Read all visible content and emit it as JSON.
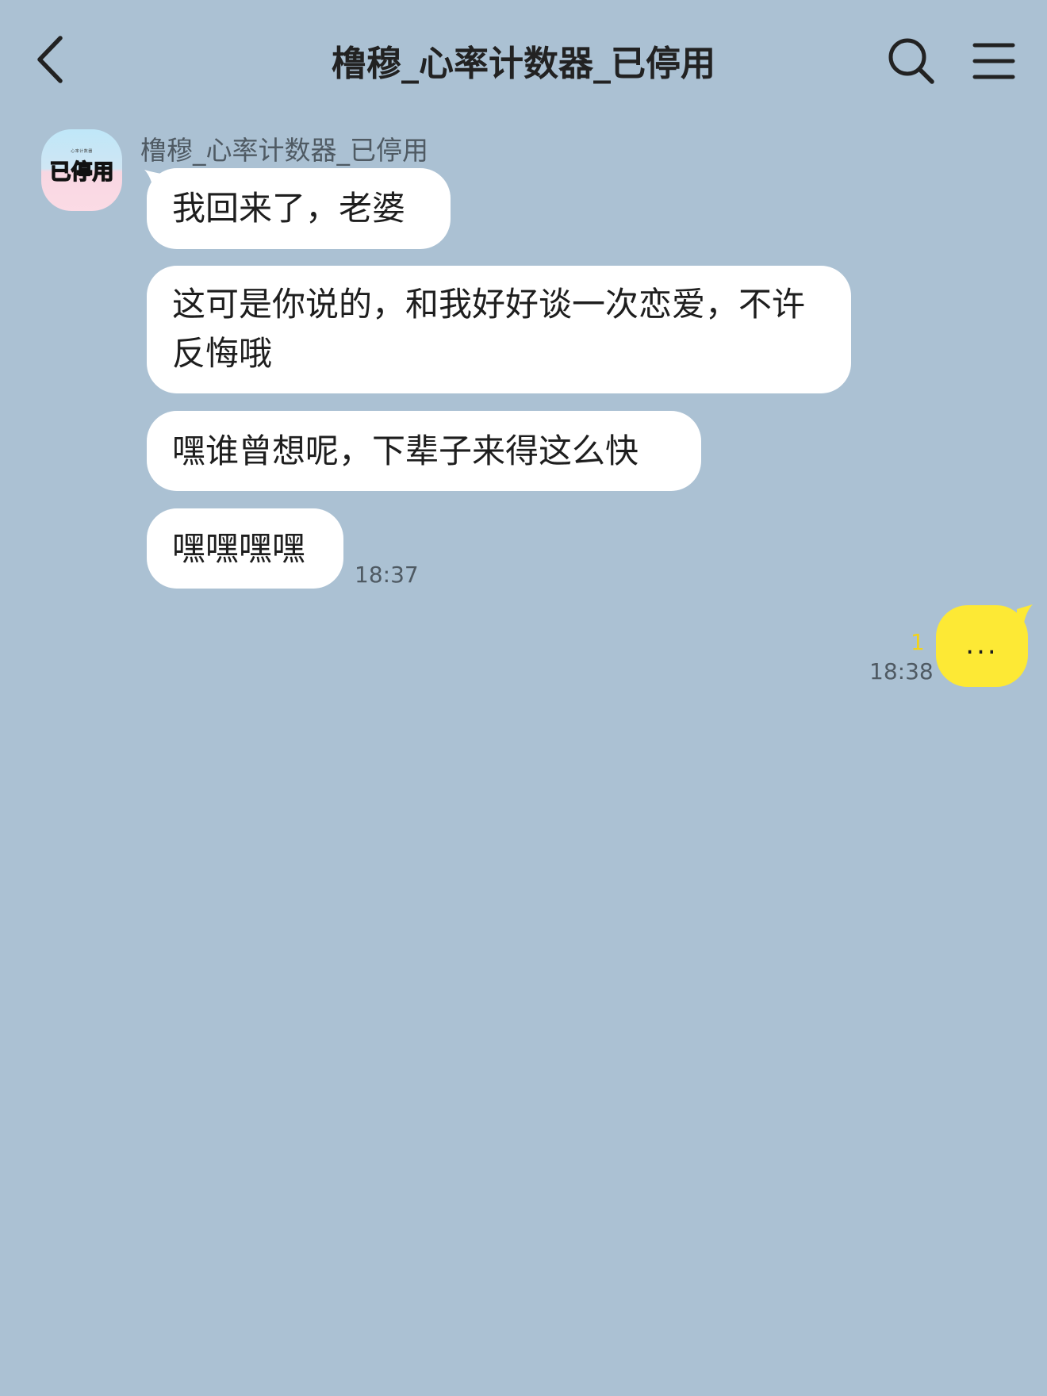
{
  "header": {
    "title": "橹穆_心率计数器_已停用",
    "icons": [
      "back-arrow-icon",
      "search-icon",
      "menu-icon"
    ]
  },
  "contact": {
    "name": "橹穆_心率计数器_已停用",
    "avatar_text": "已停用",
    "avatar_small_text": "心率计数器"
  },
  "messages": [
    {
      "text": "我回来了，老婆"
    },
    {
      "text": "这可是你说的，和我好好谈一次恋爱，不许反悔哦"
    },
    {
      "text": "嘿谁曾想呢，下辈子来得这么快"
    },
    {
      "text": "嘿嘿嘿嘿",
      "time": "18:37"
    }
  ],
  "my_message": {
    "text": "...",
    "unread": "1",
    "time": "18:38"
  },
  "colors": {
    "background": "#abc1d3",
    "incoming_bubble": "#ffffff",
    "outgoing_bubble": "#fde935",
    "unread": "#f2d21b"
  }
}
